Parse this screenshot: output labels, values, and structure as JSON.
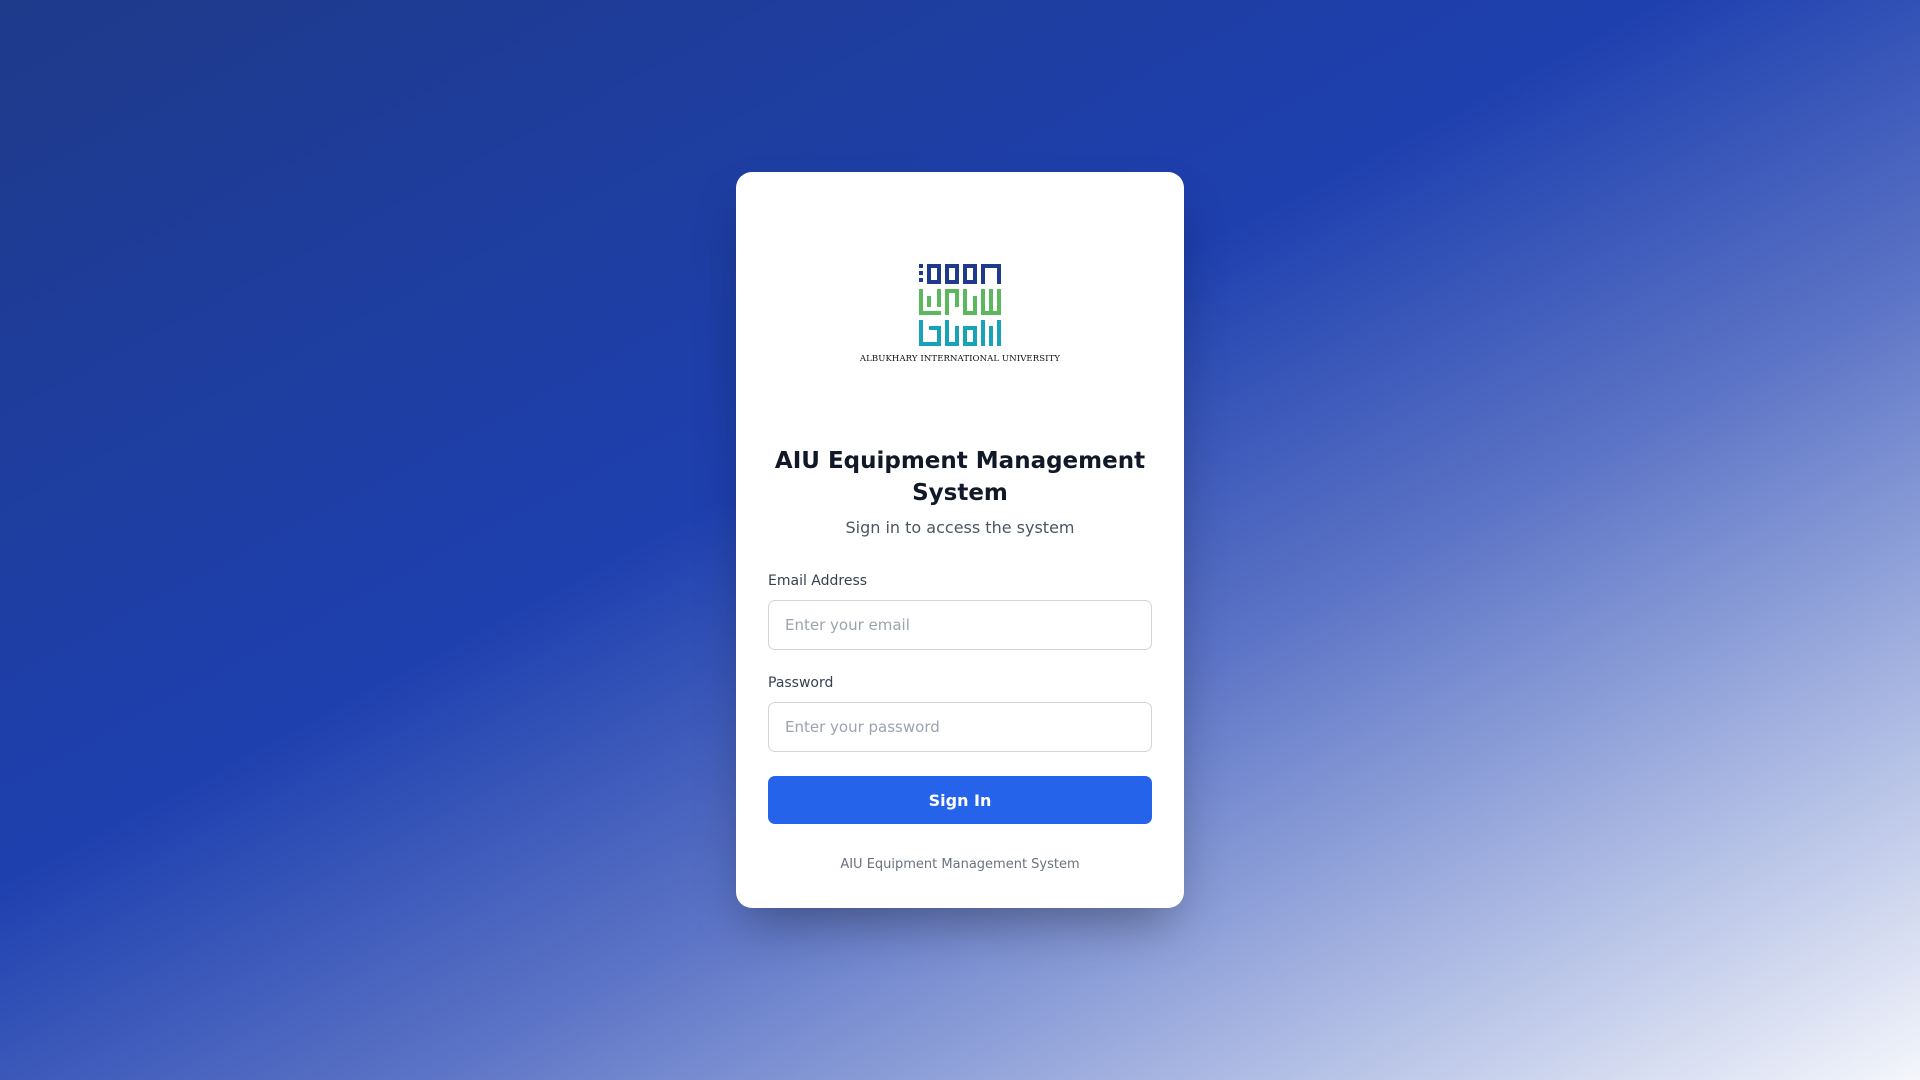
{
  "login": {
    "logo_caption": "ALBUKHARY INTERNATIONAL UNIVERSITY",
    "title": "AIU Equipment Management System",
    "subtitle": "Sign in to access the system",
    "email": {
      "label": "Email Address",
      "placeholder": "Enter your email",
      "value": ""
    },
    "password": {
      "label": "Password",
      "placeholder": "Enter your password",
      "value": ""
    },
    "sign_in_label": "Sign In",
    "footer": "AIU Equipment Management System"
  },
  "colors": {
    "primary": "#2563eb",
    "logo_navy": "#1e3a8a",
    "logo_green": "#5cb85c",
    "logo_teal": "#17a2b8",
    "background_start": "#1e3a8a",
    "background_end": "#f4f6fb"
  },
  "icons": {
    "logo": "aiu-kufic-logo"
  }
}
